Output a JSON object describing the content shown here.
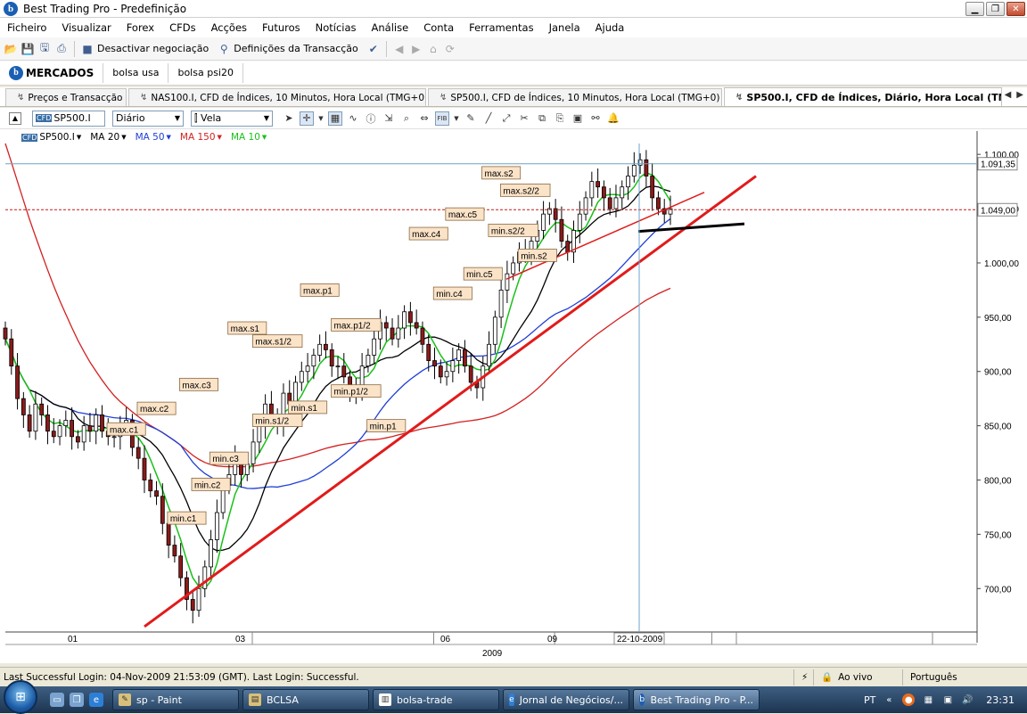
{
  "window": {
    "title": "Best Trading Pro - Predefinição",
    "logo_letter": "b"
  },
  "menu": [
    "Ficheiro",
    "Visualizar",
    "Forex",
    "CFDs",
    "Acções",
    "Futuros",
    "Notícias",
    "Análise",
    "Conta",
    "Ferramentas",
    "Janela",
    "Ajuda"
  ],
  "toolbar": {
    "deactivate_label": "Desactivar negociação",
    "settings_label": "Definições da Transacção"
  },
  "markets": {
    "tabs": [
      "MERCADOS",
      "bolsa usa",
      "bolsa psi20"
    ]
  },
  "doc_tabs": [
    "Preços e Transacção",
    "NAS100.I, CFD de Índices, 10 Minutos, Hora Local (TMG+0)",
    "SP500.I, CFD de Índices, 10 Minutos, Hora Local (TMG+0)",
    "SP500.I, CFD de Índices, Diário, Hora Local (TMG+0)"
  ],
  "chart_toolbar": {
    "symbol": "SP500.I",
    "symbol_badge": "CFD",
    "timeframe": "Diário",
    "chart_style": "Vela"
  },
  "legend": {
    "symbol": "SP500.I",
    "items": [
      {
        "label": "MA 20",
        "color": "#000000"
      },
      {
        "label": "MA 50",
        "color": "#1f3fd6"
      },
      {
        "label": "MA 150",
        "color": "#d42020"
      },
      {
        "label": "MA 10",
        "color": "#19c019"
      }
    ]
  },
  "chart_data": {
    "type": "candlestick",
    "ylim": [
      660,
      1110
    ],
    "y_ticks": [
      700,
      750,
      800,
      850,
      900,
      950,
      1000,
      1050,
      1100
    ],
    "y_tick_labels": [
      "700,00",
      "750,00",
      "800,00",
      "850,00",
      "900,00",
      "950,00",
      "1.000,00",
      "1.050,00",
      "1.100,00"
    ],
    "x_tick_labels": [
      "01",
      "03",
      "06",
      "09"
    ],
    "x_year_label": "2009",
    "crosshair_date": "22-10-2009",
    "current_price": 1049.0,
    "current_price_label": "1.049,00",
    "cursor_price": 1091.35,
    "cursor_price_label": "1.091,35",
    "series_close": [
      930,
      905,
      875,
      860,
      845,
      870,
      860,
      845,
      840,
      850,
      855,
      840,
      835,
      850,
      845,
      860,
      845,
      840,
      840,
      850,
      855,
      830,
      820,
      800,
      790,
      785,
      760,
      740,
      730,
      710,
      690,
      680,
      700,
      720,
      745,
      770,
      795,
      805,
      820,
      805,
      815,
      835,
      850,
      870,
      860,
      850,
      880,
      870,
      890,
      900,
      905,
      915,
      925,
      920,
      905,
      905,
      895,
      880,
      885,
      905,
      915,
      930,
      945,
      940,
      930,
      940,
      955,
      945,
      940,
      925,
      910,
      905,
      895,
      900,
      910,
      920,
      905,
      890,
      885,
      905,
      925,
      950,
      975,
      990,
      1000,
      1010,
      1010,
      1020,
      1030,
      1045,
      1050,
      1040,
      1020,
      1010,
      1030,
      1045,
      1060,
      1075,
      1070,
      1060,
      1050,
      1060,
      1070,
      1080,
      1090,
      1095,
      1080,
      1060,
      1050,
      1045,
      1050
    ],
    "annotations": [
      {
        "text": "max.c1",
        "date_index": 20,
        "value": 847
      },
      {
        "text": "max.c2",
        "date_index": 25,
        "value": 866
      },
      {
        "text": "max.c3",
        "date_index": 32,
        "value": 888
      },
      {
        "text": "max.s1",
        "date_index": 40,
        "value": 940
      },
      {
        "text": "max.s1/2",
        "date_index": 45,
        "value": 928
      },
      {
        "text": "max.p1",
        "date_index": 52,
        "value": 975
      },
      {
        "text": "max.p1/2",
        "date_index": 58,
        "value": 943
      },
      {
        "text": "max.c4",
        "date_index": 70,
        "value": 1027
      },
      {
        "text": "max.c5",
        "date_index": 76,
        "value": 1045
      },
      {
        "text": "max.s2",
        "date_index": 82,
        "value": 1083
      },
      {
        "text": "max.s2/2",
        "date_index": 86,
        "value": 1067
      },
      {
        "text": "min.c1",
        "date_index": 30,
        "value": 765
      },
      {
        "text": "min.c2",
        "date_index": 34,
        "value": 796
      },
      {
        "text": "min.c3",
        "date_index": 37,
        "value": 820
      },
      {
        "text": "min.s1/2",
        "date_index": 45,
        "value": 855
      },
      {
        "text": "min.s1",
        "date_index": 50,
        "value": 867
      },
      {
        "text": "min.p1/2",
        "date_index": 58,
        "value": 882
      },
      {
        "text": "min.p1",
        "date_index": 63,
        "value": 850
      },
      {
        "text": "min.c4",
        "date_index": 74,
        "value": 972
      },
      {
        "text": "min.c5",
        "date_index": 79,
        "value": 990
      },
      {
        "text": "min.s2/2",
        "date_index": 84,
        "value": 1030
      },
      {
        "text": "min.s2",
        "date_index": 88,
        "value": 1007
      }
    ]
  },
  "status": {
    "login": "Last Successful Login: 04-Nov-2009 21:53:09 (GMT). Last Login: Successful.",
    "live": "Ao vivo",
    "language": "Português"
  },
  "taskbar": {
    "buttons": [
      "sp - Paint",
      "BCLSA",
      "bolsa-trade",
      "Jornal de Negócios/...",
      "Best Trading Pro - P..."
    ],
    "lang": "PT",
    "clock": "23:31"
  },
  "colors": {
    "candle_up": "#ffffff",
    "candle_down": "#8b1a1a",
    "trendline": "#e11b1b",
    "support": "#000000",
    "price_line": "#c21a1a"
  }
}
